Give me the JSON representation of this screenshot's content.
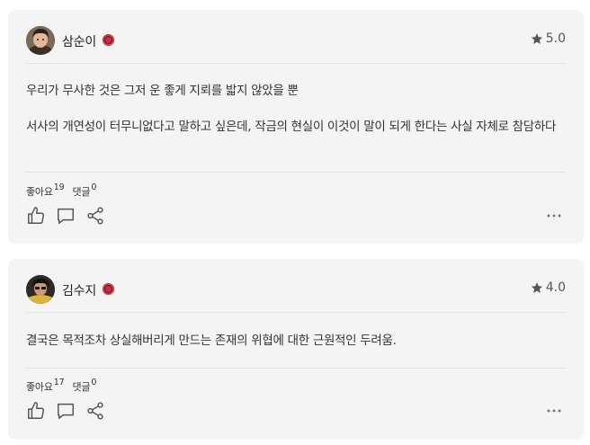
{
  "reviews": [
    {
      "author": "삼순이",
      "rating": "5.0",
      "paragraphs": [
        "우리가 무사한 것은 그저 운 좋게 지뢰를 밟지 않았을 뿐",
        "서사의 개연성이 터무니없다고 말하고 싶은데, 작금의 현실이 이것이 말이 되게 한다는 사실 자체로 참담하다"
      ],
      "likes_label": "좋아요",
      "likes_count": "19",
      "comments_label": "댓글",
      "comments_count": "0"
    },
    {
      "author": "김수지",
      "rating": "4.0",
      "paragraphs": [
        "결국은 목적조차 상실해버리게 만드는 존재의 위협에 대한 근원적인 두려움."
      ],
      "likes_label": "좋아요",
      "likes_count": "17",
      "comments_label": "댓글",
      "comments_count": "0"
    }
  ],
  "icons": {
    "star": "star-icon",
    "like": "thumbs-up-icon",
    "comment": "comment-icon",
    "share": "share-icon",
    "more": "more-horizontal-icon",
    "badge": "watcha-badge-icon"
  },
  "colors": {
    "card_bg": "#f4f4f4",
    "badge_ring": "#e33a3a",
    "icon": "#555555"
  }
}
